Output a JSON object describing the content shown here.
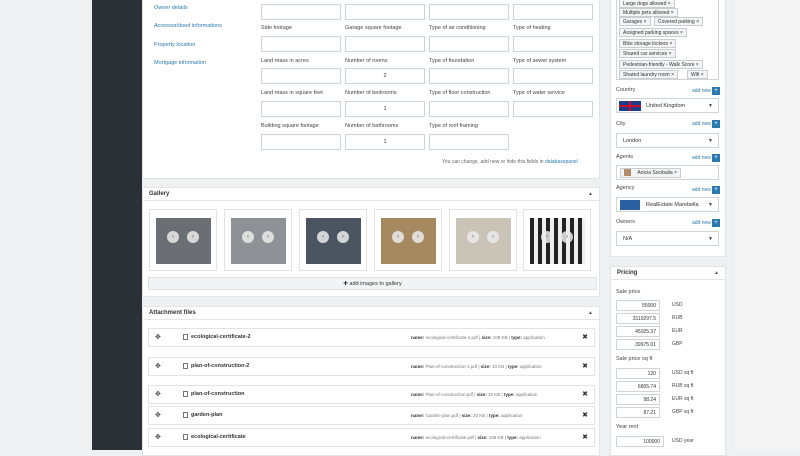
{
  "nav": {
    "links": [
      "Owner details",
      "Accessor/deed informations",
      "Property location",
      "Mortgage information"
    ]
  },
  "fields": [
    {
      "label": "Side footage",
      "value": ""
    },
    {
      "label": "Garage square footage",
      "value": ""
    },
    {
      "label": "Type of air conditioning",
      "value": ""
    },
    {
      "label": "Type of heating",
      "value": ""
    },
    {
      "label": "Land mass in acres",
      "value": ""
    },
    {
      "label": "Number of rooms",
      "value": "2"
    },
    {
      "label": "Type of foundation",
      "value": ""
    },
    {
      "label": "Type of sewer system",
      "value": ""
    },
    {
      "label": "Land mass in square feet",
      "value": ""
    },
    {
      "label": "Number of bedrooms",
      "value": "1"
    },
    {
      "label": "Type of floor construction",
      "value": ""
    },
    {
      "label": "Type of water service",
      "value": ""
    },
    {
      "label": "Building square footage",
      "value": ""
    },
    {
      "label": "Number of bathrooms",
      "value": "1"
    },
    {
      "label": "Type of roof framing",
      "value": ""
    }
  ],
  "note": {
    "text": "You can change, add new or hide this fields in",
    "link": "databasepanel"
  },
  "gallery": {
    "title": "Gallery",
    "add_label": "add images to gallery",
    "thumb_colors": [
      "#6b6f74",
      "#8e9196",
      "#4a5561",
      "#a7895f",
      "#c9c3b8",
      "#3b3b3b"
    ]
  },
  "attachments": {
    "title": "Attachment files",
    "name_key": "name:",
    "size_key": "size:",
    "type_key": "type:",
    "items": [
      {
        "name": "ecological-certificate-2",
        "file": "ecological-certificate-1.pdf",
        "size": "108 KB",
        "type": "application"
      },
      {
        "name": "plan-of-construction-2",
        "file": "Plan-of-construction-1.pdf",
        "size": "33 KB",
        "type": "application"
      },
      {
        "name": "plan-of-construction",
        "file": "Plan-of-construction.pdf",
        "size": "33 KB",
        "type": "application"
      },
      {
        "name": "garden-plan",
        "file": "Garden-plan.pdf",
        "size": "20 KB",
        "type": "application"
      },
      {
        "name": "ecological-certificate",
        "file": "ecological-certificate.pdf",
        "size": "108 KB",
        "type": "application"
      }
    ]
  },
  "features": [
    "Large dogs allowed",
    "Multiple pets allowed",
    "Garages",
    "Covered parking",
    "Assigned parking spaces",
    "Bike storage lockers",
    "Shared car services",
    "Pedestrian-friendly - Walk Score",
    "Shared laundry room",
    "Wifi"
  ],
  "right": {
    "add_new": "add new",
    "country_label": "Country",
    "country_value": "United Kingdom",
    "city_label": "City",
    "city_value": "London",
    "agents_label": "Agents",
    "agent_value": "Anicia Socibalia",
    "agency_label": "Agency",
    "agency_value": "RealEstate Marebella",
    "owners_label": "Owners",
    "owners_value": "N/A"
  },
  "pricing": {
    "title": "Pricing",
    "sale_price_label": "Sale price",
    "sale_price": [
      {
        "value": "55000",
        "currency": "USD"
      },
      {
        "value": "3119297.5",
        "currency": "RUB"
      },
      {
        "value": "45025.37",
        "currency": "EUR"
      },
      {
        "value": "39975.01",
        "currency": "GBP"
      }
    ],
    "sqft_label": "Sale price sq ft",
    "sqft": [
      {
        "value": "120",
        "currency": "USD sq ft"
      },
      {
        "value": "6805.74",
        "currency": "RUB sq ft"
      },
      {
        "value": "98.24",
        "currency": "EUR sq ft"
      },
      {
        "value": "87.21",
        "currency": "GBP sq ft"
      }
    ],
    "rent_label": "Year rent",
    "rent": {
      "value": "100000",
      "currency": "USD year"
    }
  },
  "colors": {
    "accent": "#2a7ab0",
    "sidebar": "#2b2f36"
  }
}
